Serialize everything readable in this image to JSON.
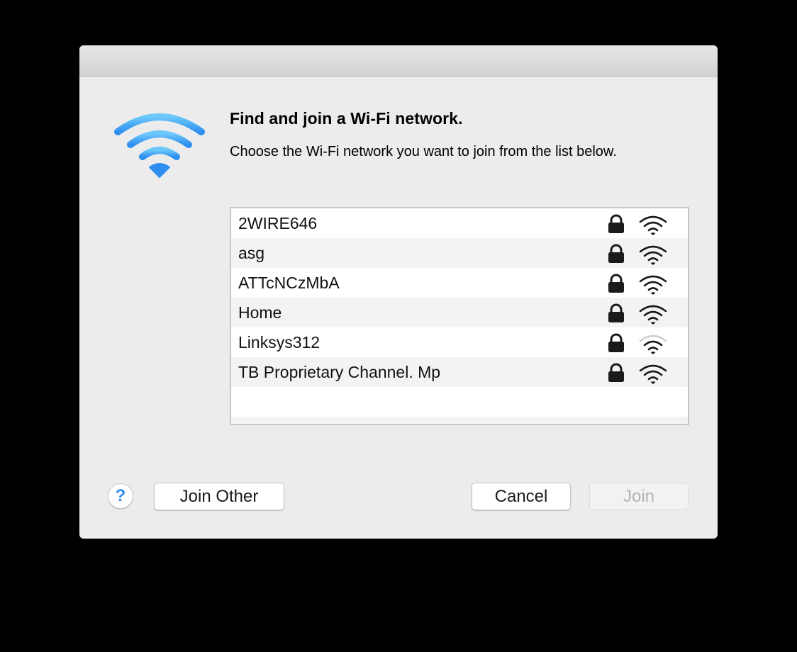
{
  "dialog": {
    "heading": "Find and join a Wi-Fi network.",
    "description": "Choose the Wi-Fi network you want to join from the list below.",
    "accent_color": "#5ab8f5"
  },
  "networks": [
    {
      "name": "2WIRE646",
      "secured": true,
      "signal_bars": 4,
      "signal_max": 4
    },
    {
      "name": "asg",
      "secured": true,
      "signal_bars": 4,
      "signal_max": 4
    },
    {
      "name": "ATTcNCzMbA",
      "secured": true,
      "signal_bars": 4,
      "signal_max": 4
    },
    {
      "name": "Home",
      "secured": true,
      "signal_bars": 4,
      "signal_max": 4
    },
    {
      "name": "Linksys312",
      "secured": true,
      "signal_bars": 3,
      "signal_max": 4
    },
    {
      "name": "TB Proprietary Channel. Mp",
      "secured": true,
      "signal_bars": 4,
      "signal_max": 4
    }
  ],
  "buttons": {
    "help": "?",
    "join_other": "Join Other",
    "cancel": "Cancel",
    "join": "Join",
    "join_enabled": false
  },
  "icons": {
    "hero": "wifi-icon",
    "lock": "lock-icon",
    "signal": "wifi-signal-icon",
    "help": "help-icon"
  }
}
